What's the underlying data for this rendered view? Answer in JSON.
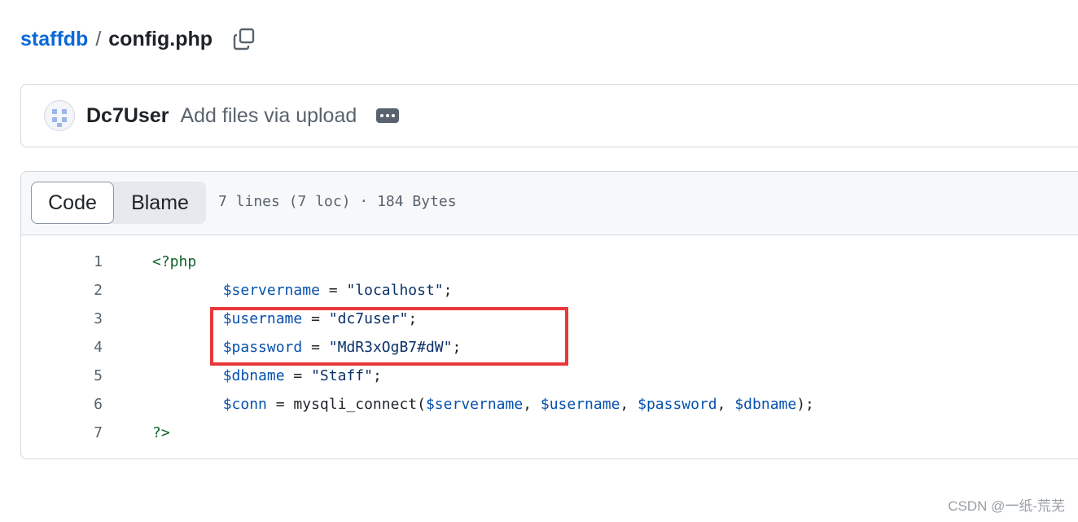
{
  "breadcrumb": {
    "repo": "staffdb",
    "separator": "/",
    "file": "config.php",
    "copy_icon": "copy-icon"
  },
  "commit": {
    "avatar_icon": "user-avatar",
    "author": "Dc7User",
    "message": "Add files via upload",
    "more_icon": "ellipsis-icon"
  },
  "file": {
    "tabs": {
      "code": "Code",
      "blame": "Blame",
      "active": "Code"
    },
    "stats": "7 lines (7 loc) · 184 Bytes",
    "lines": [
      {
        "number": "1",
        "tokens": [
          {
            "t": "tag",
            "v": "<?php"
          }
        ]
      },
      {
        "number": "2",
        "tokens": [
          {
            "t": "plain",
            "v": "        "
          },
          {
            "t": "var",
            "v": "$servername"
          },
          {
            "t": "plain",
            "v": " = "
          },
          {
            "t": "str",
            "v": "\"localhost\""
          },
          {
            "t": "plain",
            "v": ";"
          }
        ]
      },
      {
        "number": "3",
        "tokens": [
          {
            "t": "plain",
            "v": "        "
          },
          {
            "t": "var",
            "v": "$username"
          },
          {
            "t": "plain",
            "v": " = "
          },
          {
            "t": "str",
            "v": "\"dc7user\""
          },
          {
            "t": "plain",
            "v": ";"
          }
        ]
      },
      {
        "number": "4",
        "tokens": [
          {
            "t": "plain",
            "v": "        "
          },
          {
            "t": "var",
            "v": "$password"
          },
          {
            "t": "plain",
            "v": " = "
          },
          {
            "t": "str",
            "v": "\"MdR3xOgB7#dW\""
          },
          {
            "t": "plain",
            "v": ";"
          }
        ]
      },
      {
        "number": "5",
        "tokens": [
          {
            "t": "plain",
            "v": "        "
          },
          {
            "t": "var",
            "v": "$dbname"
          },
          {
            "t": "plain",
            "v": " = "
          },
          {
            "t": "str",
            "v": "\"Staff\""
          },
          {
            "t": "plain",
            "v": ";"
          }
        ]
      },
      {
        "number": "6",
        "tokens": [
          {
            "t": "plain",
            "v": "        "
          },
          {
            "t": "var",
            "v": "$conn"
          },
          {
            "t": "plain",
            "v": " = mysqli_connect("
          },
          {
            "t": "var",
            "v": "$servername"
          },
          {
            "t": "plain",
            "v": ", "
          },
          {
            "t": "var",
            "v": "$username"
          },
          {
            "t": "plain",
            "v": ", "
          },
          {
            "t": "var",
            "v": "$password"
          },
          {
            "t": "plain",
            "v": ", "
          },
          {
            "t": "var",
            "v": "$dbname"
          },
          {
            "t": "plain",
            "v": ");"
          }
        ]
      },
      {
        "number": "7",
        "tokens": [
          {
            "t": "tag",
            "v": "?>"
          }
        ]
      }
    ]
  },
  "annotation": {
    "highlight_lines": [
      "3",
      "4"
    ],
    "color": "#e8383a"
  },
  "watermark": "CSDN @一纸-荒芜",
  "colors": {
    "link": "#0969da",
    "muted": "#59636e",
    "border": "#d1d9e0",
    "php_tag": "#116329",
    "php_var": "#0550ae",
    "php_string": "#0a3069"
  }
}
